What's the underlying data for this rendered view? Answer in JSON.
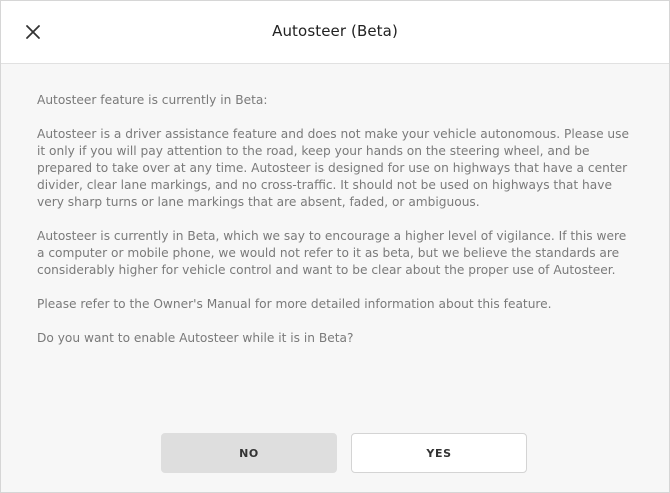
{
  "dialog": {
    "title": "Autosteer (Beta)",
    "close_icon": "close-icon"
  },
  "content": {
    "paragraphs": [
      "Autosteer feature is currently in Beta:",
      "Autosteer is a driver assistance feature and does not make your vehicle autonomous. Please use it only if you will pay attention to the road, keep your hands on the steering wheel, and be prepared to take over at any time. Autosteer is designed for use on highways that have a center divider, clear lane markings, and no cross-traffic. It should not be used on highways that have very sharp turns or lane markings that are absent, faded, or ambiguous.",
      "Autosteer is currently in Beta, which we say to encourage a higher level of vigilance. If this were a computer or mobile phone, we would not refer to it as beta, but we believe the standards are considerably higher for vehicle control and want to be clear about the proper use of Autosteer.",
      "Please refer to the Owner's Manual for more detailed information about this feature.",
      "Do you want to enable Autosteer while it is in Beta?"
    ]
  },
  "buttons": {
    "no_label": "NO",
    "yes_label": "YES"
  },
  "colors": {
    "body_text": "#7a7a7a",
    "title_text": "#222222",
    "no_button_bg": "#dedede",
    "yes_button_bg": "#ffffff"
  }
}
